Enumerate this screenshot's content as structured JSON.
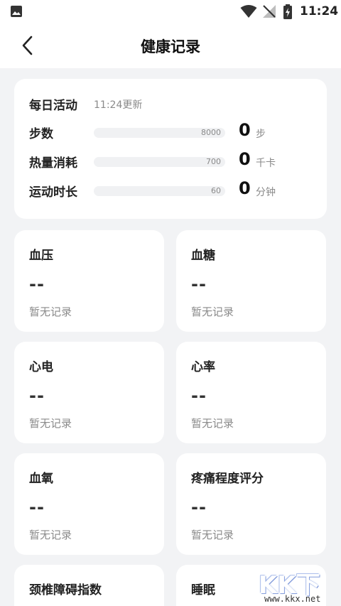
{
  "status_bar": {
    "time": "11:24",
    "icons": [
      "image-icon",
      "wifi-icon",
      "no-signal-icon",
      "battery-charging-icon"
    ]
  },
  "header": {
    "title": "健康记录",
    "back_icon": "chevron-left-icon"
  },
  "daily_activity": {
    "title": "每日活动",
    "updated": "11:24更新",
    "items": [
      {
        "label": "步数",
        "target": "8000",
        "value": "0",
        "unit": "步",
        "progress": 0
      },
      {
        "label": "热量消耗",
        "target": "700",
        "value": "0",
        "unit": "千卡",
        "progress": 0
      },
      {
        "label": "运动时长",
        "target": "60",
        "value": "0",
        "unit": "分钟",
        "progress": 0
      }
    ]
  },
  "metrics": [
    {
      "title": "血压",
      "value": "--",
      "note": "暂无记录"
    },
    {
      "title": "血糖",
      "value": "--",
      "note": "暂无记录"
    },
    {
      "title": "心电",
      "value": "--",
      "note": "暂无记录"
    },
    {
      "title": "心率",
      "value": "--",
      "note": "暂无记录"
    },
    {
      "title": "血氧",
      "value": "--",
      "note": "暂无记录"
    },
    {
      "title": "疼痛程度评分",
      "value": "--",
      "note": "暂无记录"
    },
    {
      "title": "颈椎障碍指数"
    },
    {
      "title": "睡眠"
    }
  ],
  "watermark": {
    "text": "KK下载",
    "url": "www.kkx.net"
  },
  "colors": {
    "background": "#f2f3f5",
    "card": "#ffffff",
    "muted_text": "#8a8a8a",
    "progress_track": "#f0f1f3"
  }
}
